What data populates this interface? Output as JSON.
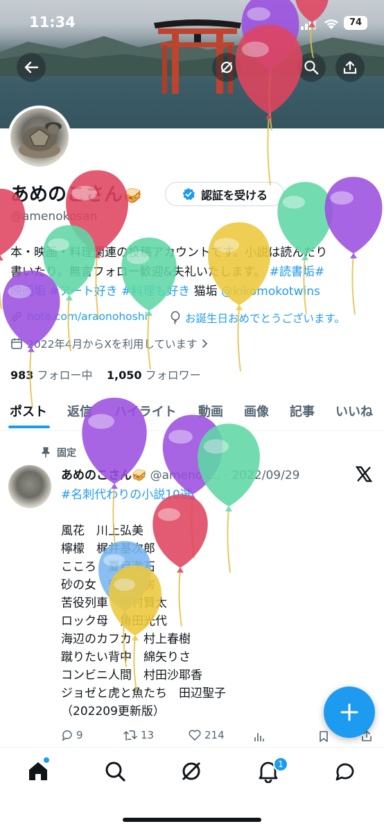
{
  "status_bar": {
    "time": "11:34",
    "battery": "74"
  },
  "profile": {
    "name": "あめのこさん",
    "name_emoji": "🥪",
    "verify_button_label": "認証を受ける",
    "handle": "@amenokosan",
    "bio_line1": "本・映画・料理関連の投稿アカウントです。小説は読んだり",
    "bio_line2_text": "書いたり。無言フォロー歓迎&失礼いたします。",
    "bio_line2_tag": "#読書垢",
    "bio_line2_hash": "#",
    "bio_line3_tags": "映画垢 #アート好き #料理も好き",
    "bio_line3_text": " 猫垢 ",
    "bio_line3_mention": "@kikomokotwins",
    "website": "note.com/araonohoshi",
    "birthday": "お誕生日おめでとうございます。",
    "joined": "2022年4月からXを利用しています",
    "following_count": "983",
    "following_label": "フォロー中",
    "followers_count": "1,050",
    "followers_label": "フォロワー"
  },
  "tabs": [
    {
      "label": "ポスト"
    },
    {
      "label": "返信"
    },
    {
      "label": "ハイライト"
    },
    {
      "label": "動画"
    },
    {
      "label": "画像"
    },
    {
      "label": "記事"
    },
    {
      "label": "いいね"
    }
  ],
  "pinned_post": {
    "pinned_label": "固定",
    "author_name": "あめのこさん",
    "author_emoji": "🥪",
    "handle": "@amenok...",
    "date": "· 2022/09/29",
    "hashtag": "#名刺代わりの小説10選",
    "lines": [
      "風花　川上弘美",
      "檸檬　梶井基次郎",
      "こころ　夏目漱石",
      "砂の女　安部公房",
      "苦役列車　西村賢太",
      "ロック母　角田光代",
      "海辺のカフカ　村上春樹",
      "蹴りたい背中　綿矢りさ",
      "コンビニ人間　村田沙耶香",
      "ジョゼと虎と魚たち　田辺聖子",
      "（202209更新版）"
    ],
    "replies": "9",
    "reposts": "13",
    "likes": "214"
  },
  "bottom_nav": {
    "notifications_badge": "1"
  },
  "colors": {
    "accent": "#1d9bf0",
    "text": "#0f1419",
    "muted": "#536471"
  },
  "icons": [
    "back-arrow-icon",
    "grok-icon",
    "search-icon",
    "share-icon",
    "verified-badge-icon",
    "link-icon",
    "balloon-icon",
    "calendar-icon",
    "pin-icon",
    "x-logo-icon",
    "reply-icon",
    "repost-icon",
    "like-icon",
    "views-icon",
    "bookmark-icon",
    "home-icon",
    "explore-icon",
    "bell-icon",
    "messages-icon",
    "compose-plus-icon"
  ]
}
